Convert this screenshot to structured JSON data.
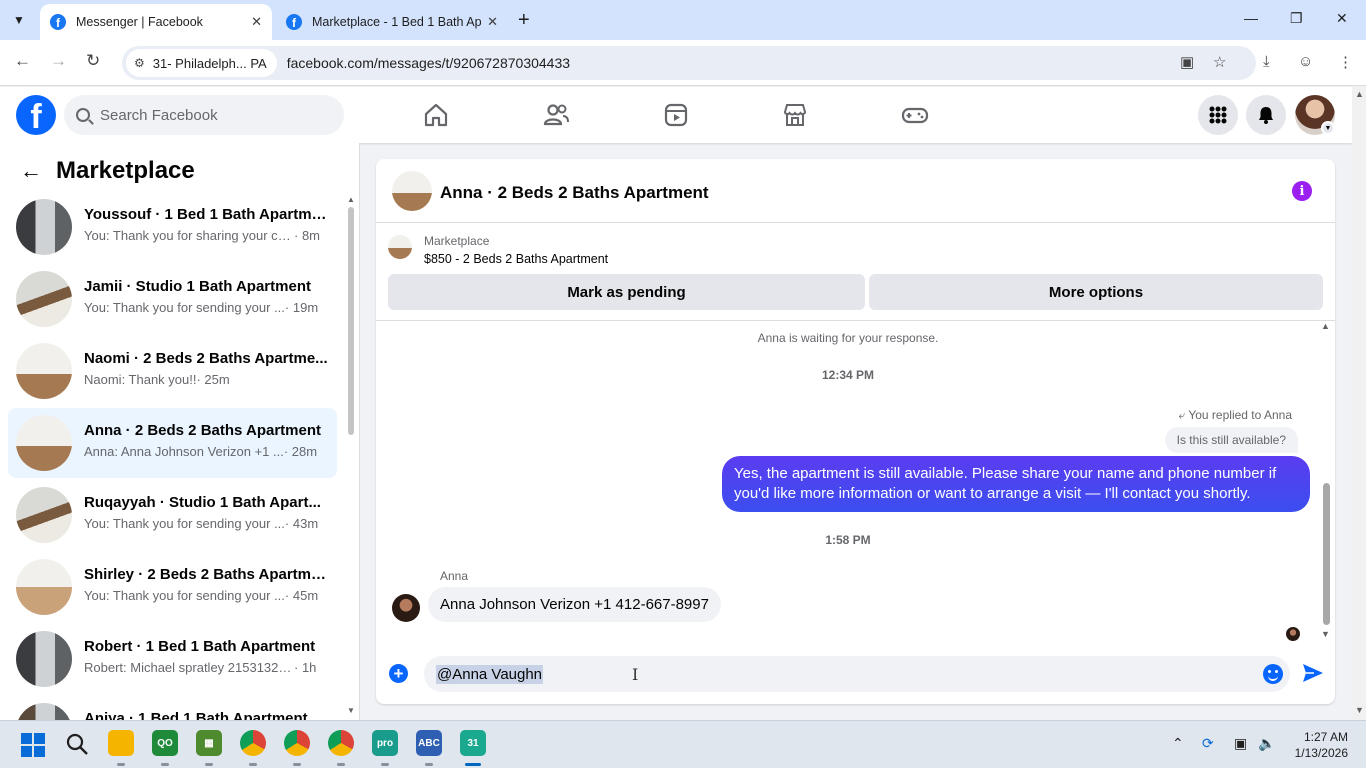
{
  "browser": {
    "tabs": [
      {
        "title": "Messenger | Facebook",
        "active": true
      },
      {
        "title": "Marketplace - 1 Bed 1 Bath Apa",
        "active": false
      }
    ],
    "site_chip": "31- Philadelph... PA",
    "url": "facebook.com/messages/t/920672870304433"
  },
  "facebook": {
    "search_placeholder": "Search Facebook"
  },
  "sidebar": {
    "title": "Marketplace",
    "conversations": [
      {
        "name": "Youssouf · 1 Bed 1 Bath Apartment",
        "preview": "You: Thank you for sharing your co...",
        "time": "· 8m"
      },
      {
        "name": "Jamii · Studio 1 Bath Apartment",
        "preview": "You: Thank you for sending your ...",
        "time": "· 19m"
      },
      {
        "name": "Naomi · 2 Beds 2 Baths Apartme...",
        "preview": "Naomi: Thank you!!",
        "time": "· 25m"
      },
      {
        "name": "Anna · 2 Beds 2 Baths Apartment",
        "preview": "Anna: Anna Johnson Verizon +1 ...",
        "time": "· 28m"
      },
      {
        "name": "Ruqayyah · Studio 1 Bath Apart...",
        "preview": "You: Thank you for sending your ...",
        "time": "· 43m"
      },
      {
        "name": "Shirley · 2 Beds 2 Baths Apartme...",
        "preview": "You: Thank you for sending your ...",
        "time": "· 45m"
      },
      {
        "name": "Robert · 1 Bed 1 Bath Apartment",
        "preview": "Robert: Michael spratley 2153132002",
        "time": "· 1h"
      },
      {
        "name": "Aniya · 1 Bed 1 Bath Apartment",
        "preview": "",
        "time": ""
      }
    ]
  },
  "chat": {
    "title": "Anna · 2 Beds 2 Baths Apartment",
    "marketplace_label": "Marketplace",
    "listing": "$850 - 2 Beds 2 Baths Apartment",
    "mark_pending_label": "Mark as pending",
    "more_options_label": "More options",
    "waiting_text": "Anna is waiting for your response.",
    "time1": "12:34 PM",
    "reply_note": "You replied to Anna",
    "quoted_text": "Is this still available?",
    "outgoing_message": "Yes, the apartment is still available. Please share your name and phone number if you'd like more information or want to arrange a visit — I'll contact you shortly.",
    "time2": "1:58 PM",
    "sender_name": "Anna",
    "incoming_message": "Anna Johnson Verizon  +1 412-667-8997",
    "composer_text": "@Anna Vaughn"
  },
  "taskbar": {
    "clock_time": "1:27 AM",
    "clock_date": "1/13/2026"
  },
  "colors": {
    "fb_blue": "#0866ff",
    "outgoing_bubble": "#4b3bf0",
    "selected_conv_bg": "#ebf5ff"
  }
}
